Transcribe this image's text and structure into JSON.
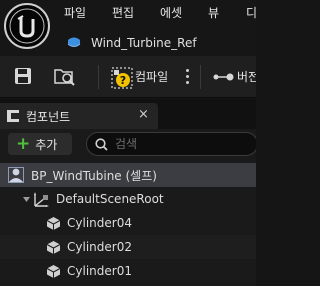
{
  "menu": {
    "items": [
      "파일",
      "편집",
      "에셋",
      "뷰",
      "디"
    ]
  },
  "asset_tab": {
    "title": "Wind_Turbine_Ref"
  },
  "toolbar": {
    "compile_label": "컴파일",
    "version_label": "버전"
  },
  "components_panel": {
    "tab_label": "컴포넌트",
    "close_label": "×",
    "add_label": "추가",
    "search_placeholder": "검색",
    "tree": {
      "root": "BP_WindTubine (셀프)",
      "scene_root": "DefaultSceneRoot",
      "children": [
        "Cylinder04",
        "Cylinder02",
        "Cylinder01"
      ]
    }
  },
  "colors": {
    "accent_green": "#4fbf3c",
    "compile_warning": "#f2c200",
    "selected_row": "#3b3d42",
    "blueprint_blue": "#3f8fe0"
  },
  "icons": [
    "unreal-logo-icon",
    "blueprint-icon",
    "save-icon",
    "browse-icon",
    "compile-icon",
    "more-options-icon",
    "version-icon",
    "components-tab-icon",
    "close-icon",
    "plus-icon",
    "search-icon",
    "actor-icon",
    "expand-arrow-icon",
    "scene-root-icon",
    "static-mesh-icon"
  ]
}
